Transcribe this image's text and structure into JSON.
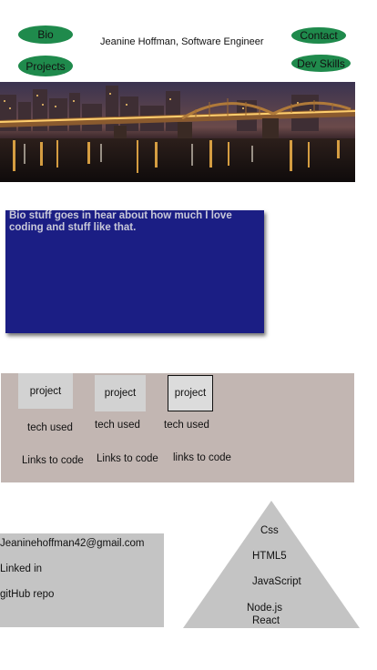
{
  "nav": {
    "bio": "Bio",
    "projects": "Projects",
    "contact": "Contact",
    "dev_skills": "Dev Skills"
  },
  "header": {
    "title": "Jeanine Hoffman, Software Engineer"
  },
  "bio": {
    "text": "Bio stuff goes in hear about how much I love coding and stuff like that."
  },
  "projects": [
    {
      "title": "project",
      "tech": "tech used",
      "links": "Links to code"
    },
    {
      "title": "project",
      "tech": "tech used",
      "links": "Links to code"
    },
    {
      "title": "project",
      "tech": "tech used",
      "links": "links to code"
    }
  ],
  "contact": {
    "email": "Jeaninehoffman42@gmail.com",
    "linkedin": "Linked in",
    "github": "gitHub repo"
  },
  "skills": [
    "Css",
    "HTML5",
    "JavaScript",
    "Node.js",
    "React"
  ],
  "colors": {
    "nav_pill": "#1f8a4c",
    "bio_card": "#1b1e84",
    "projects_bg": "#c2b6b2",
    "contact_bg": "#c4c4c4"
  }
}
